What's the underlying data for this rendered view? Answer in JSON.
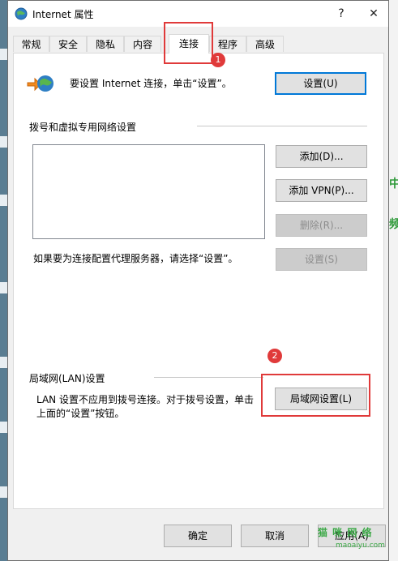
{
  "window": {
    "title": "Internet 属性",
    "help_label": "?",
    "close_label": "✕"
  },
  "tabs": [
    {
      "label": "常规"
    },
    {
      "label": "安全"
    },
    {
      "label": "隐私"
    },
    {
      "label": "内容"
    },
    {
      "label": "连接",
      "active": true
    },
    {
      "label": "程序"
    },
    {
      "label": "高级"
    }
  ],
  "setup": {
    "text": "要设置 Internet 连接，单击“设置”。",
    "button": "设置(U)"
  },
  "dialup": {
    "group_label": "拨号和虚拟专用网络设置",
    "add_button": "添加(D)...",
    "add_vpn_button": "添加 VPN(P)...",
    "delete_button": "删除(R)...",
    "settings_button": "设置(S)",
    "proxy_text": "如果要为连接配置代理服务器，请选择“设置”。"
  },
  "lan": {
    "group_label": "局域网(LAN)设置",
    "text_line1": "LAN 设置不应用到拨号连接。对于拨号设置，单击",
    "text_line2": "上面的“设置”按钮。",
    "button": "局域网设置(L)"
  },
  "footer": {
    "ok": "确定",
    "cancel": "取消",
    "apply": "应用(A)"
  },
  "annotations": {
    "step1": "1",
    "step2": "2",
    "color": "#e03a3a"
  },
  "watermark": {
    "text": "猫 咪 网 络",
    "sub": "maoaiyu.com"
  }
}
